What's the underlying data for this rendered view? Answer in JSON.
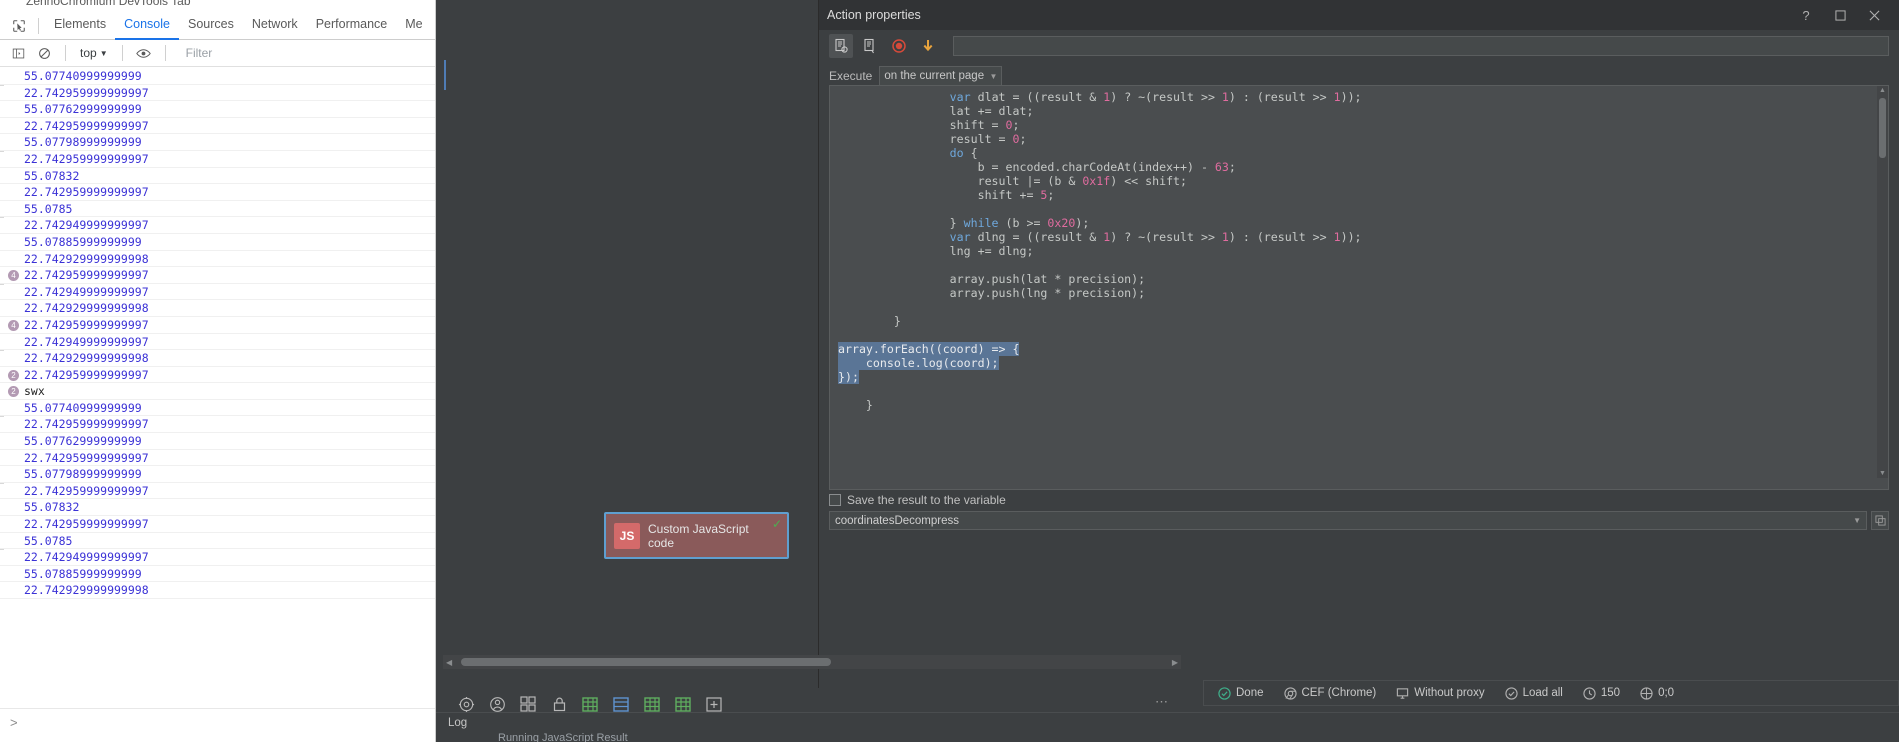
{
  "devtools": {
    "window_title": "ZennoChromium DevTools Tab",
    "inspect_icon": "inspect-element-icon",
    "tabs": [
      {
        "label": "Elements",
        "active": false
      },
      {
        "label": "Console",
        "active": true
      },
      {
        "label": "Sources",
        "active": false
      },
      {
        "label": "Network",
        "active": false
      },
      {
        "label": "Performance",
        "active": false
      },
      {
        "label": "Me",
        "active": false
      }
    ],
    "toolbar": {
      "sidebar_icon": "console-sidebar-icon",
      "clear_icon": "clear-console-icon",
      "context_value": "top",
      "context_arrow": "chevron-down-icon",
      "eye_icon": "live-expression-eye-icon",
      "filter_placeholder": "Filter"
    },
    "prompt_icon": "console-prompt-chevron-icon",
    "log_rows": [
      {
        "text": "55.07740999999999",
        "count": "",
        "type": "num"
      },
      {
        "text": "22.742959999999997",
        "count": "",
        "type": "num"
      },
      {
        "text": "55.07762999999999",
        "count": "",
        "type": "num"
      },
      {
        "text": "22.742959999999997",
        "count": "",
        "type": "num"
      },
      {
        "text": "55.07798999999999",
        "count": "",
        "type": "num"
      },
      {
        "text": "22.742959999999997",
        "count": "",
        "type": "num"
      },
      {
        "text": "55.07832",
        "count": "",
        "type": "num"
      },
      {
        "text": "22.742959999999997",
        "count": "",
        "type": "num"
      },
      {
        "text": "55.0785",
        "count": "",
        "type": "num"
      },
      {
        "text": "22.742949999999997",
        "count": "",
        "type": "num"
      },
      {
        "text": "55.07885999999999",
        "count": "",
        "type": "num"
      },
      {
        "text": "22.742929999999998",
        "count": "",
        "type": "num"
      },
      {
        "text": "22.742959999999997",
        "count": "4",
        "type": "num"
      },
      {
        "text": "22.742949999999997",
        "count": "",
        "type": "num"
      },
      {
        "text": "22.742929999999998",
        "count": "",
        "type": "num"
      },
      {
        "text": "22.742959999999997",
        "count": "4",
        "type": "num"
      },
      {
        "text": "22.742949999999997",
        "count": "",
        "type": "num"
      },
      {
        "text": "22.742929999999998",
        "count": "",
        "type": "num"
      },
      {
        "text": "22.742959999999997",
        "count": "2",
        "type": "num"
      },
      {
        "text": "swx",
        "count": "2",
        "type": "txt"
      },
      {
        "text": "55.07740999999999",
        "count": "",
        "type": "num"
      },
      {
        "text": "22.742959999999997",
        "count": "",
        "type": "num"
      },
      {
        "text": "55.07762999999999",
        "count": "",
        "type": "num"
      },
      {
        "text": "22.742959999999997",
        "count": "",
        "type": "num"
      },
      {
        "text": "55.07798999999999",
        "count": "",
        "type": "num"
      },
      {
        "text": "22.742959999999997",
        "count": "",
        "type": "num"
      },
      {
        "text": "55.07832",
        "count": "",
        "type": "num"
      },
      {
        "text": "22.742959999999997",
        "count": "",
        "type": "num"
      },
      {
        "text": "55.0785",
        "count": "",
        "type": "num"
      },
      {
        "text": "22.742949999999997",
        "count": "",
        "type": "num"
      },
      {
        "text": "55.07885999999999",
        "count": "",
        "type": "num"
      },
      {
        "text": "22.742929999999998",
        "count": "",
        "type": "num"
      }
    ]
  },
  "js_node": {
    "badge": "JS",
    "label": "Custom JavaScript code",
    "check_icon": "checkmark-icon"
  },
  "dialog": {
    "title": "Action properties",
    "help_icon": "help-question-icon",
    "maximize_icon": "maximize-window-icon",
    "close_icon": "close-window-icon",
    "toolbar": [
      {
        "icon": "script-settings-icon",
        "selected": true
      },
      {
        "icon": "script-list-icon",
        "selected": false
      },
      {
        "icon": "record-icon",
        "selected": false
      },
      {
        "icon": "download-arrow-icon",
        "selected": false
      }
    ],
    "execute_label": "Execute",
    "execute_value": "on the current page",
    "execute_arrow": "chevron-down-icon",
    "save_result_label": "Save the result to the variable",
    "save_result_icon": "variable-save-icon",
    "variable_value": "coordinatesDecompress",
    "variable_arrow": "chevron-down-icon",
    "variable_ext_icon": "external-editor-icon",
    "scroll_up_icon": "scroll-up-icon",
    "scroll_down_icon": "scroll-down-icon"
  },
  "code": {
    "lines": [
      {
        "indent": 4,
        "tokens": [
          {
            "t": "var ",
            "c": "k"
          },
          {
            "t": "dlat = ((result & "
          },
          {
            "t": "1",
            "c": "n"
          },
          {
            "t": ") ? ~(result >> "
          },
          {
            "t": "1",
            "c": "n"
          },
          {
            "t": ") : (result >> "
          },
          {
            "t": "1",
            "c": "n"
          },
          {
            "t": "));"
          }
        ]
      },
      {
        "indent": 4,
        "tokens": [
          {
            "t": "lat += dlat;"
          }
        ]
      },
      {
        "indent": 4,
        "tokens": [
          {
            "t": "shift = "
          },
          {
            "t": "0",
            "c": "n"
          },
          {
            "t": ";"
          }
        ]
      },
      {
        "indent": 4,
        "tokens": [
          {
            "t": "result = "
          },
          {
            "t": "0",
            "c": "n"
          },
          {
            "t": ";"
          }
        ]
      },
      {
        "indent": 4,
        "tokens": [
          {
            "t": "do ",
            "c": "k"
          },
          {
            "t": "{"
          }
        ]
      },
      {
        "indent": 5,
        "tokens": [
          {
            "t": "b = encoded.charCodeAt(index++) - "
          },
          {
            "t": "63",
            "c": "n"
          },
          {
            "t": ";"
          }
        ]
      },
      {
        "indent": 5,
        "tokens": [
          {
            "t": "result |= (b & "
          },
          {
            "t": "0x1f",
            "c": "n"
          },
          {
            "t": ") << shift;"
          }
        ]
      },
      {
        "indent": 5,
        "tokens": [
          {
            "t": "shift += "
          },
          {
            "t": "5",
            "c": "n"
          },
          {
            "t": ";"
          }
        ]
      },
      {
        "indent": 0,
        "tokens": []
      },
      {
        "indent": 4,
        "tokens": [
          {
            "t": "} "
          },
          {
            "t": "while ",
            "c": "k"
          },
          {
            "t": "(b >= "
          },
          {
            "t": "0x20",
            "c": "n"
          },
          {
            "t": ");"
          }
        ]
      },
      {
        "indent": 4,
        "tokens": [
          {
            "t": "var ",
            "c": "k"
          },
          {
            "t": "dlng = ((result & "
          },
          {
            "t": "1",
            "c": "n"
          },
          {
            "t": ") ? ~(result >> "
          },
          {
            "t": "1",
            "c": "n"
          },
          {
            "t": ") : (result >> "
          },
          {
            "t": "1",
            "c": "n"
          },
          {
            "t": "));"
          }
        ]
      },
      {
        "indent": 4,
        "tokens": [
          {
            "t": "lng += dlng;"
          }
        ]
      },
      {
        "indent": 0,
        "tokens": []
      },
      {
        "indent": 4,
        "tokens": [
          {
            "t": "array.push(lat * precision);"
          }
        ]
      },
      {
        "indent": 4,
        "tokens": [
          {
            "t": "array.push(lng * precision);"
          }
        ]
      },
      {
        "indent": 0,
        "tokens": []
      },
      {
        "indent": 2,
        "tokens": [
          {
            "t": "}"
          }
        ]
      },
      {
        "indent": 0,
        "tokens": []
      },
      {
        "indent": 0,
        "tokens": [
          {
            "t": "array.forEach((coord) => {",
            "c": "hl"
          }
        ]
      },
      {
        "indent": 1,
        "tokens": [
          {
            "t": "    console.log(coord);",
            "c": "hl",
            "raw": true
          }
        ]
      },
      {
        "indent": 0,
        "tokens": [
          {
            "t": "});",
            "c": "hl"
          }
        ]
      },
      {
        "indent": 0,
        "tokens": []
      },
      {
        "indent": 1,
        "tokens": [
          {
            "t": "}"
          }
        ]
      }
    ]
  },
  "canvas_toolbar": {
    "icons": [
      {
        "name": "settings-gear-icon",
        "color": "plain"
      },
      {
        "name": "user-profile-icon",
        "color": "plain"
      },
      {
        "name": "grid-view-icon",
        "color": "plain"
      },
      {
        "name": "lock-icon",
        "color": "plain"
      },
      {
        "name": "table-green-icon",
        "color": "green"
      },
      {
        "name": "table-blue-icon",
        "color": "blue"
      },
      {
        "name": "table-green-2-icon",
        "color": "green"
      },
      {
        "name": "table-green-3-icon",
        "color": "green"
      },
      {
        "name": "add-table-icon",
        "color": "plain"
      }
    ],
    "overflow_icon": "more-options-icon",
    "scroll_left_icon": "scroll-left-arrow-icon",
    "scroll_right_icon": "scroll-right-arrow-icon"
  },
  "statusbar": {
    "items": [
      {
        "icon": "status-done-icon",
        "label": "Done",
        "color": "#3fae8a"
      },
      {
        "icon": "browser-chrome-icon",
        "label": "CEF (Chrome)",
        "color": "#b0b0b0"
      },
      {
        "icon": "proxy-monitor-icon",
        "label": "Without proxy",
        "color": "#b0b0b0"
      },
      {
        "icon": "load-all-icon",
        "label": "Load all",
        "color": "#b0b0b0"
      },
      {
        "icon": "timer-icon",
        "label": "150",
        "color": "#b0b0b0"
      },
      {
        "icon": "coords-icon",
        "label": "0;0",
        "color": "#b0b0b0"
      }
    ]
  },
  "logpanel": {
    "title": "Log",
    "entry": "Running JavaScript Result"
  }
}
